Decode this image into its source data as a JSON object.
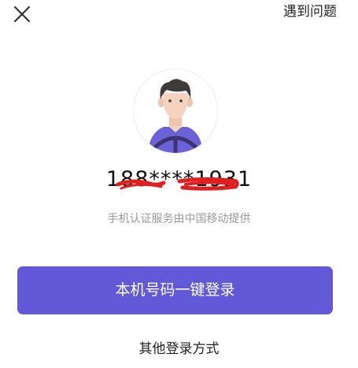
{
  "header": {
    "close_icon": "close-icon",
    "help_label": "遇到问题"
  },
  "avatar": {
    "icon": "driver-avatar-icon",
    "skin_color": "#f6d3bf",
    "hair_color": "#3f3b3a",
    "shirt_color": "#6c62d8",
    "wheel_color": "#3b3470"
  },
  "account": {
    "masked_phone": "188****1931",
    "redaction_color": "#e02020"
  },
  "provider_text": "手机认证服务由中国移动提供",
  "actions": {
    "one_click_login_label": "本机号码一键登录",
    "other_login_label": "其他登录方式"
  },
  "colors": {
    "primary": "#6259d8",
    "text": "#222222",
    "muted": "#9a9a9a"
  }
}
